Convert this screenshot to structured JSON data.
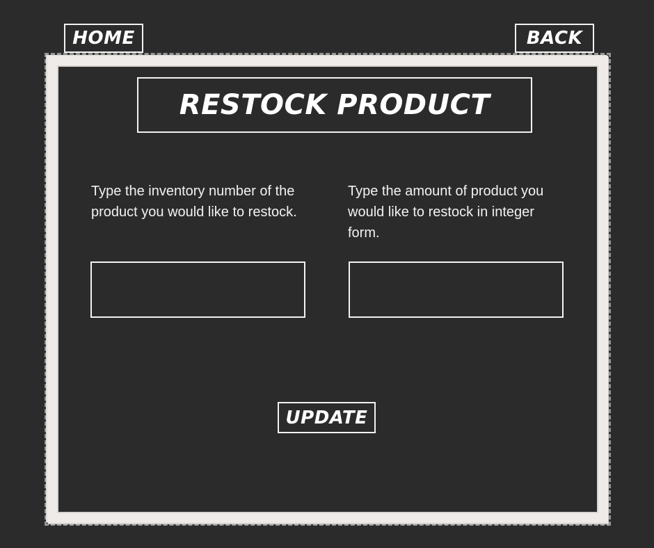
{
  "nav": {
    "home_label": "HOME",
    "back_label": "BACK"
  },
  "page": {
    "title": "RESTOCK PRODUCT"
  },
  "form": {
    "inventory_prompt": "Type the inventory number of the product you would like to restock.",
    "inventory_value": "",
    "amount_prompt": "Type the amount of product you would like to restock in integer form.",
    "amount_value": "",
    "update_label": "UPDATE"
  },
  "colors": {
    "background": "#2b2b2b",
    "frame": "#eeebe8",
    "text": "#f2f2f2"
  }
}
